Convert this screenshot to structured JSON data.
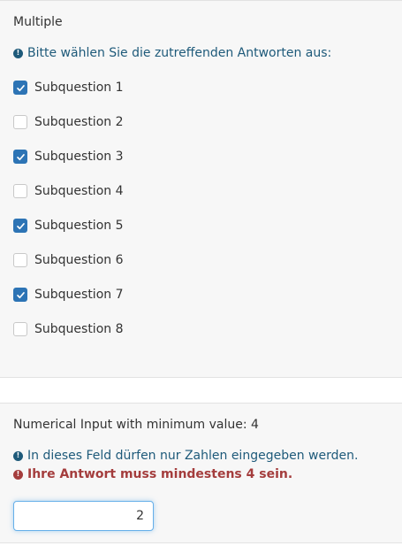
{
  "multiple": {
    "title": "Multiple",
    "tip": "Bitte wählen Sie die zutreffenden Antworten aus:",
    "options": [
      {
        "label": "Subquestion 1",
        "checked": true
      },
      {
        "label": "Subquestion 2",
        "checked": false
      },
      {
        "label": "Subquestion 3",
        "checked": true
      },
      {
        "label": "Subquestion 4",
        "checked": false
      },
      {
        "label": "Subquestion 5",
        "checked": true
      },
      {
        "label": "Subquestion 6",
        "checked": false
      },
      {
        "label": "Subquestion 7",
        "checked": true
      },
      {
        "label": "Subquestion 8",
        "checked": false
      }
    ]
  },
  "numerical": {
    "title": "Numerical Input with minimum value: 4",
    "tip_info": "In dieses Feld dürfen nur Zahlen eingegeben werden.",
    "tip_error": "Ihre Antwort muss mindestens 4 sein.",
    "value": "2"
  },
  "icons": {
    "info": "!",
    "error": "!"
  },
  "colors": {
    "accent": "#2d74b5",
    "info": "#1e5a7a",
    "error": "#a43d3d",
    "panel": "#f7f7f7",
    "focus_border": "#66afe9"
  }
}
